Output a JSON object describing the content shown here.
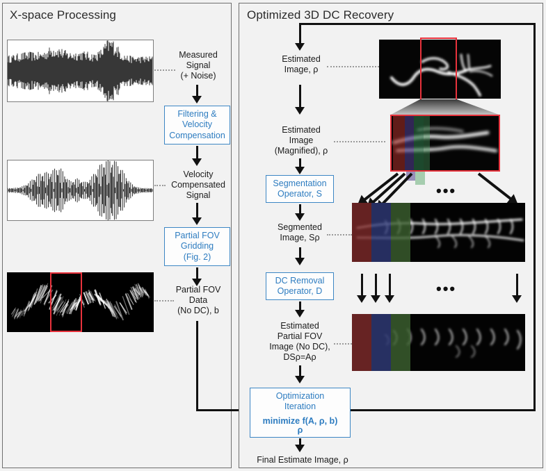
{
  "left_panel": {
    "title": "X-space Processing",
    "labels": {
      "measured_signal": "Measured\nSignal\n(+ Noise)",
      "velocity_compensated": "Velocity\nCompensated\nSignal",
      "partial_fov_data": "Partial FOV\nData\n(No DC), b"
    },
    "boxes": {
      "filtering": "Filtering &\nVelocity\nCompensation",
      "gridding": "Partial FOV\nGridding\n(Fig. 2)"
    },
    "images": {
      "measured_signal_plot": "noisy-waveform",
      "velocity_compensated_plot": "enveloped-waveform",
      "partial_fov_image": "partial-fov-kspace"
    }
  },
  "right_panel": {
    "title": "Optimized 3D DC Recovery",
    "labels": {
      "estimated_image": "Estimated\nImage, ρ",
      "estimated_image_magnified": "Estimated\nImage\n(Magnified), ρ",
      "segmented_image": "Segmented\nImage, Sρ",
      "estimated_partial_fov": "Estimated\nPartial FOV\nImage (No DC),\nDSρ=Aρ",
      "final_estimate": "Final Estimate Image, ρ"
    },
    "boxes": {
      "segmentation": "Segmentation\nOperator, S",
      "dc_removal": "DC Removal\nOperator, D",
      "optimization_line1": "Optimization",
      "optimization_line2": "Iteration",
      "optimization_line3": "minimize f(A, ρ, b)",
      "optimization_line4": "ρ"
    },
    "ellipsis": "•••",
    "images": {
      "estimated_image": "vessel-mip",
      "magnified_image": "vessel-magnified",
      "segmented_image": "segmented-slabs",
      "dc_removed_image": "dc-removed-slabs"
    }
  },
  "colors": {
    "panel_bg": "#f2f2f2",
    "panel_border": "#6e6e6e",
    "box_blue": "#3c86c4",
    "text_blue": "#2d7cc0",
    "text_dark": "#1b1b1b",
    "red_highlight": "#e8323c",
    "band_red": "#7e2b2b",
    "band_blue": "#2f3a78",
    "band_green": "#3c6030",
    "arrow_black": "#111111",
    "dotted_gray": "#9a9a9a"
  }
}
